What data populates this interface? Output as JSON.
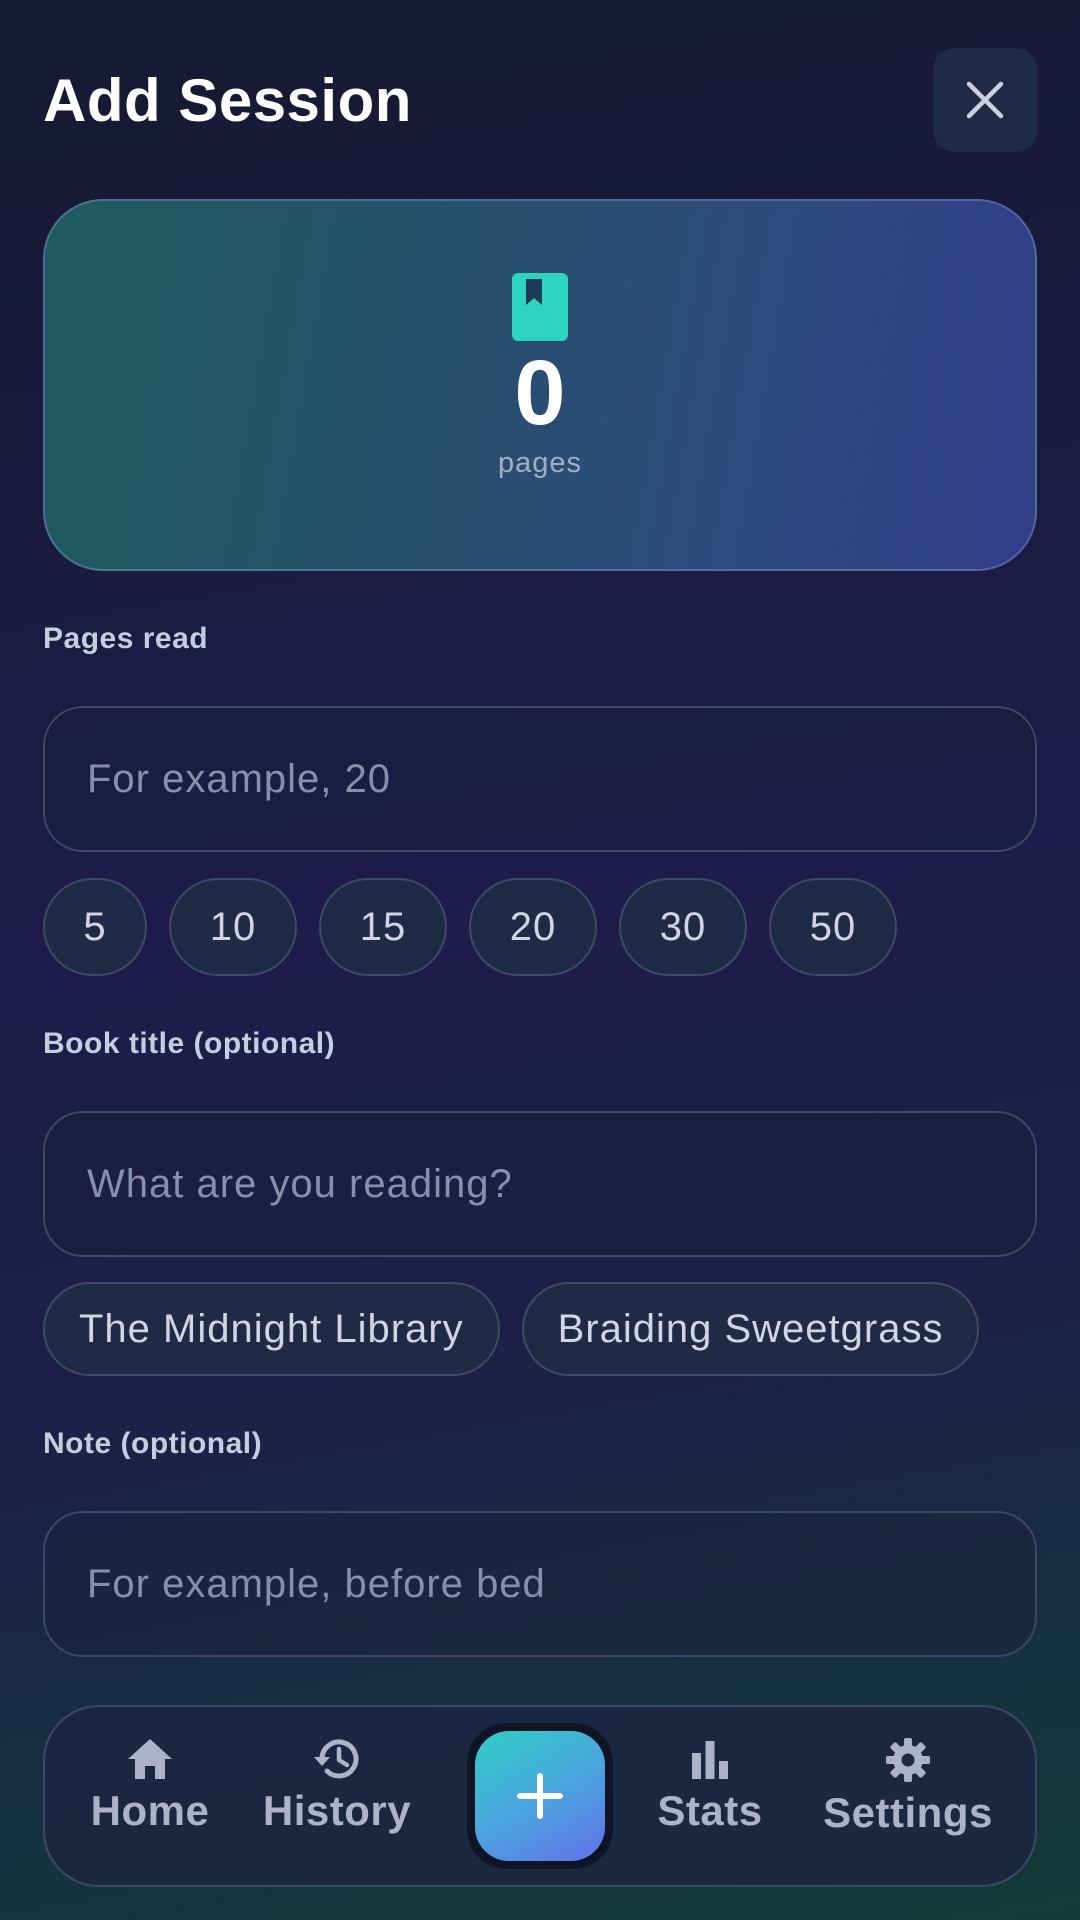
{
  "header": {
    "title": "Add Session",
    "close_icon": "close-icon"
  },
  "hero": {
    "icon": "book-icon",
    "count": "0",
    "unit": "pages",
    "icon_color": "#2dd4bf"
  },
  "pages_read": {
    "label": "Pages read",
    "placeholder": "For example, 20",
    "quick_values": [
      "5",
      "10",
      "15",
      "20",
      "30",
      "50"
    ]
  },
  "book_title": {
    "label": "Book title (optional)",
    "placeholder": "What are you reading?",
    "suggestions": [
      "The Midnight Library",
      "Braiding Sweetgrass"
    ]
  },
  "note": {
    "label": "Note (optional)",
    "placeholder": "For example, before bed"
  },
  "nav": {
    "items": [
      {
        "label": "Home",
        "icon": "home-icon"
      },
      {
        "label": "History",
        "icon": "history-icon"
      },
      {
        "label": "Stats",
        "icon": "stats-icon"
      },
      {
        "label": "Settings",
        "icon": "settings-icon"
      }
    ],
    "fab_icon": "plus-icon"
  }
}
